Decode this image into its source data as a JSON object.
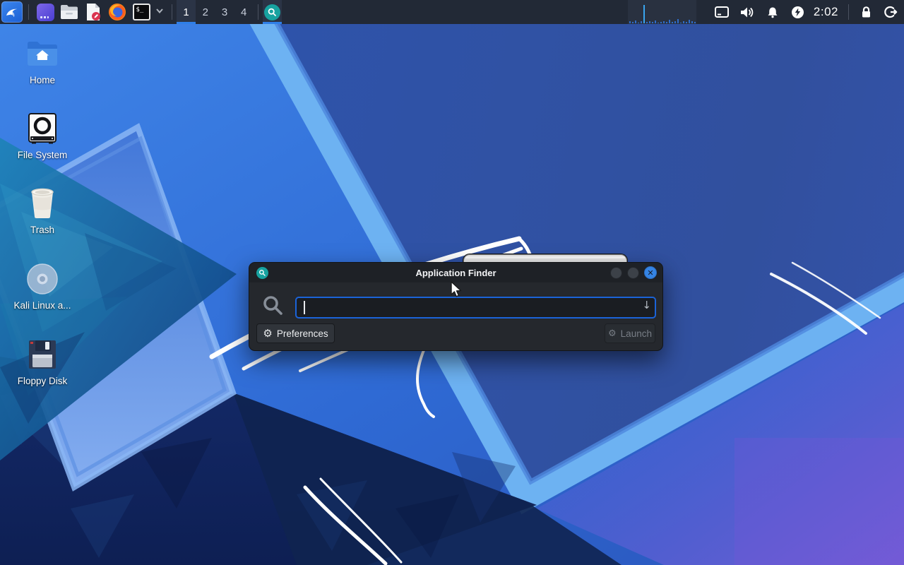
{
  "panel": {
    "launchers": [
      {
        "name": "kali-menu"
      },
      {
        "name": "purple-app"
      },
      {
        "name": "file-manager"
      },
      {
        "name": "text-editor"
      },
      {
        "name": "firefox"
      },
      {
        "name": "terminal",
        "glyph": "$_"
      }
    ],
    "workspaces": [
      {
        "label": "1",
        "active": true
      },
      {
        "label": "2",
        "active": false
      },
      {
        "label": "3",
        "active": false
      },
      {
        "label": "4",
        "active": false
      }
    ],
    "taskbar": [
      {
        "app": "Application Finder",
        "active": true
      }
    ],
    "cpu_graph": {
      "bars": [
        3,
        2,
        4,
        1,
        3,
        26,
        2,
        3,
        2,
        4,
        1,
        2,
        3,
        2,
        5,
        2,
        3,
        6,
        1,
        3,
        2,
        5,
        3,
        2,
        6,
        2,
        3,
        4
      ],
      "spike_index": 5,
      "bar_color": "#2e6cc9",
      "spike_color": "#39a5ef"
    },
    "clock": "2:02",
    "status_icons": [
      "display",
      "volume",
      "notifications",
      "power-manager",
      "lock-screen",
      "log-out"
    ]
  },
  "desktop": {
    "icons": [
      {
        "label": "Home"
      },
      {
        "label": "File System"
      },
      {
        "label": "Trash"
      },
      {
        "label": "Kali Linux a..."
      },
      {
        "label": "Floppy Disk"
      }
    ]
  },
  "finder": {
    "title": "Application Finder",
    "search_value": "",
    "dropdown_glyph": "↓",
    "preferences_label": "Preferences",
    "launch_label": "Launch",
    "close_glyph": "✕",
    "gear_glyph": "⚙"
  },
  "colors": {
    "panel_bg": "#222936",
    "accent_blue": "#2f7fe8",
    "input_border": "#1b63d8",
    "teal_icon": "#17a2a0",
    "close_button": "#3584e4",
    "window_bg": "#25282d"
  }
}
